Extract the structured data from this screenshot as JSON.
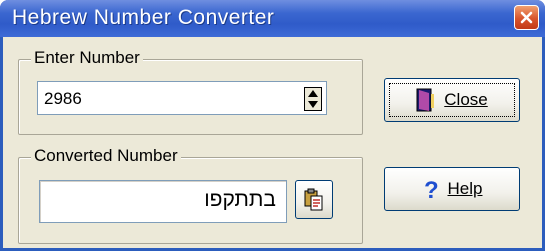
{
  "window": {
    "title": "Hebrew Number Converter"
  },
  "enter_group": {
    "legend": "Enter Number",
    "value": "2986"
  },
  "converted_group": {
    "legend": "Converted Number",
    "value": "בתתקפו"
  },
  "buttons": {
    "close_label": "Close",
    "help_label": "Help"
  },
  "icons": {
    "title_close": "close-x-icon",
    "copy": "copy-clipboard-icon",
    "close_door": "door-icon",
    "help": "question-mark-icon",
    "spin": "spin-arrows-icon"
  },
  "colors": {
    "titlebar": "#2f5bc9",
    "face": "#ece9d8",
    "close_btn": "#d8542c",
    "help_q": "#1f4fd0"
  }
}
